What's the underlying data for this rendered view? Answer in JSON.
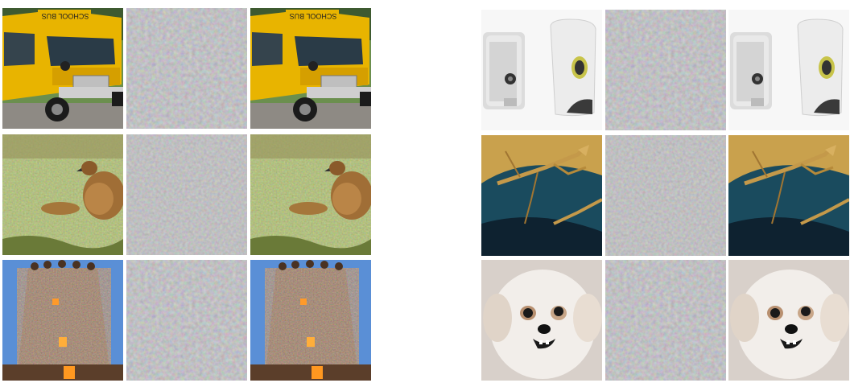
{
  "figure": {
    "left_panel": {
      "rows": [
        {
          "subject": "school-bus",
          "columns": [
            "original",
            "perturbation",
            "adversarial"
          ],
          "text_on_bus": "SCHOOL BUS"
        },
        {
          "subject": "bird-in-grass",
          "columns": [
            "original",
            "perturbation",
            "adversarial"
          ]
        },
        {
          "subject": "temple",
          "columns": [
            "original",
            "perturbation",
            "adversarial"
          ]
        }
      ]
    },
    "right_panel": {
      "rows": [
        {
          "subject": "soap-dispensers",
          "columns": [
            "original",
            "perturbation",
            "adversarial"
          ]
        },
        {
          "subject": "praying-mantis",
          "columns": [
            "original",
            "perturbation",
            "adversarial"
          ]
        },
        {
          "subject": "white-dog",
          "columns": [
            "original",
            "perturbation",
            "adversarial"
          ]
        }
      ]
    },
    "colors": {
      "noise_gray": "#8a8a8a",
      "bus_yellow": "#e8b400",
      "grass_green": "#7e8d3e",
      "sky_blue": "#5a8fd6",
      "temple_brown": "#6a4a34",
      "dispenser_white": "#eef0f2",
      "mantis_teal": "#2f6b7b",
      "dog_white": "#ebe6e2"
    }
  }
}
